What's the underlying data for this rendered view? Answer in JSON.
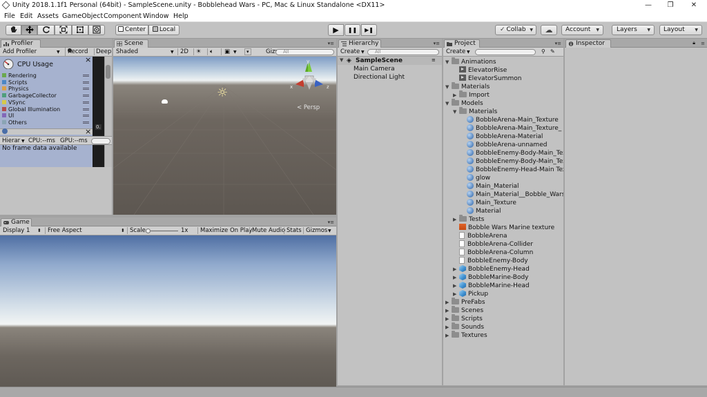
{
  "window": {
    "title": "Unity 2018.1.1f1 Personal (64bit) - SampleScene.unity - Bobblehead Wars - PC, Mac & Linux Standalone <DX11>",
    "minimize_glyph": "—",
    "maximize_glyph": "❐",
    "close_glyph": "✕"
  },
  "menu": [
    "File",
    "Edit",
    "Assets",
    "GameObject",
    "Component",
    "Window",
    "Help"
  ],
  "toolbar": {
    "pivot_label": "Center",
    "space_label": "Local",
    "collab_label": "Collab",
    "account_label": "Account",
    "layers_label": "Layers",
    "layout_label": "Layout",
    "play_glyph": "▶",
    "pause_glyph": "❚❚",
    "step_glyph": "▶❚",
    "cloud_glyph": "☁"
  },
  "profiler": {
    "tab": "Profiler",
    "add_profiler": "Add Profiler",
    "record": "Record",
    "deep": "Deep",
    "cpu_usage": "CPU Usage",
    "close_glyph": "×",
    "legend": [
      {
        "label": "Rendering",
        "color": "#6aa84f"
      },
      {
        "label": "Scripts",
        "color": "#4a86c5"
      },
      {
        "label": "Physics",
        "color": "#d9a04b"
      },
      {
        "label": "GarbageCollector",
        "color": "#4f9e7c"
      },
      {
        "label": "VSync",
        "color": "#d6c84a"
      },
      {
        "label": "Global Illumination",
        "color": "#b04d4d"
      },
      {
        "label": "UI",
        "color": "#8268b8"
      },
      {
        "label": "Others",
        "color": "#8aa4b4"
      }
    ],
    "readout": "0.",
    "hierarchy_dropdown": "Hierar",
    "cpu_ms": "CPU:--ms",
    "gpu_ms": "GPU:--ms",
    "no_data": "No frame data available"
  },
  "scene": {
    "tab": "Scene",
    "shading": "Shaded",
    "mode_2d": "2D",
    "gizmos": "Gizmos",
    "search_placeholder": "All",
    "persp": "Persp",
    "axis_x": "x",
    "axis_y": "y",
    "axis_z": "z"
  },
  "game": {
    "tab": "Game",
    "display": "Display 1",
    "aspect": "Free Aspect",
    "scale_label": "Scale",
    "scale_value": "1x",
    "maximize": "Maximize On Play",
    "mute": "Mute Audio",
    "stats": "Stats",
    "gizmos": "Gizmos"
  },
  "hierarchy": {
    "tab": "Hierarchy",
    "create": "Create",
    "search_placeholder": "All",
    "scene": "SampleScene",
    "items": [
      "Main Camera",
      "Directional Light"
    ]
  },
  "project": {
    "tab": "Project",
    "create": "Create",
    "tree": [
      {
        "label": "Animations",
        "depth": 0,
        "icon": "folder",
        "open": true
      },
      {
        "label": "ElevatorRise",
        "depth": 1,
        "icon": "anim"
      },
      {
        "label": "ElevatorSummon",
        "depth": 1,
        "icon": "anim"
      },
      {
        "label": "Materials",
        "depth": 0,
        "icon": "folder",
        "open": true
      },
      {
        "label": "Import",
        "depth": 1,
        "icon": "folder",
        "closed": true
      },
      {
        "label": "Models",
        "depth": 0,
        "icon": "folder",
        "open": true
      },
      {
        "label": "Materials",
        "depth": 1,
        "icon": "folder",
        "open": true
      },
      {
        "label": "BobbleArena-Main_Texture",
        "depth": 2,
        "icon": "sphere"
      },
      {
        "label": "BobbleArena-Main_Texture_",
        "depth": 2,
        "icon": "sphere"
      },
      {
        "label": "BobbleArena-Material",
        "depth": 2,
        "icon": "sphere"
      },
      {
        "label": "BobbleArena-unnamed",
        "depth": 2,
        "icon": "sphere"
      },
      {
        "label": "BobbleEnemy-Body-Main_Tex",
        "depth": 2,
        "icon": "sphere"
      },
      {
        "label": "BobbleEnemy-Body-Main_Tex",
        "depth": 2,
        "icon": "sphere"
      },
      {
        "label": "BobbleEnemy-Head-Main Tex",
        "depth": 2,
        "icon": "sphere"
      },
      {
        "label": "glow",
        "depth": 2,
        "icon": "sphere"
      },
      {
        "label": "Main_Material",
        "depth": 2,
        "icon": "sphere"
      },
      {
        "label": "Main_Material__Bobble_Wars",
        "depth": 2,
        "icon": "sphere"
      },
      {
        "label": "Main_Texture",
        "depth": 2,
        "icon": "sphere"
      },
      {
        "label": "Material",
        "depth": 2,
        "icon": "sphere"
      },
      {
        "label": "Tests",
        "depth": 1,
        "icon": "folder",
        "closed": true
      },
      {
        "label": "Bobble Wars Marine texture",
        "depth": 1,
        "icon": "tex"
      },
      {
        "label": "BobbleArena",
        "depth": 1,
        "icon": "doc"
      },
      {
        "label": "BobbleArena-Collider",
        "depth": 1,
        "icon": "doc"
      },
      {
        "label": "BobbleArena-Column",
        "depth": 1,
        "icon": "doc"
      },
      {
        "label": "BobbleEnemy-Body",
        "depth": 1,
        "icon": "doc"
      },
      {
        "label": "BobbleEnemy-Head",
        "depth": 1,
        "icon": "cube",
        "closed": true
      },
      {
        "label": "BobbleMarine-Body",
        "depth": 1,
        "icon": "cube",
        "closed": true
      },
      {
        "label": "BobbleMarine-Head",
        "depth": 1,
        "icon": "cube",
        "closed": true
      },
      {
        "label": "Pickup",
        "depth": 1,
        "icon": "cube",
        "closed": true
      },
      {
        "label": "PreFabs",
        "depth": 0,
        "icon": "folder",
        "closed": true
      },
      {
        "label": "Scenes",
        "depth": 0,
        "icon": "folder",
        "closed": true
      },
      {
        "label": "Scripts",
        "depth": 0,
        "icon": "folder",
        "closed": true
      },
      {
        "label": "Sounds",
        "depth": 0,
        "icon": "folder",
        "closed": true
      },
      {
        "label": "Textures",
        "depth": 0,
        "icon": "folder",
        "closed": true
      }
    ]
  },
  "inspector": {
    "tab": "Inspector"
  }
}
